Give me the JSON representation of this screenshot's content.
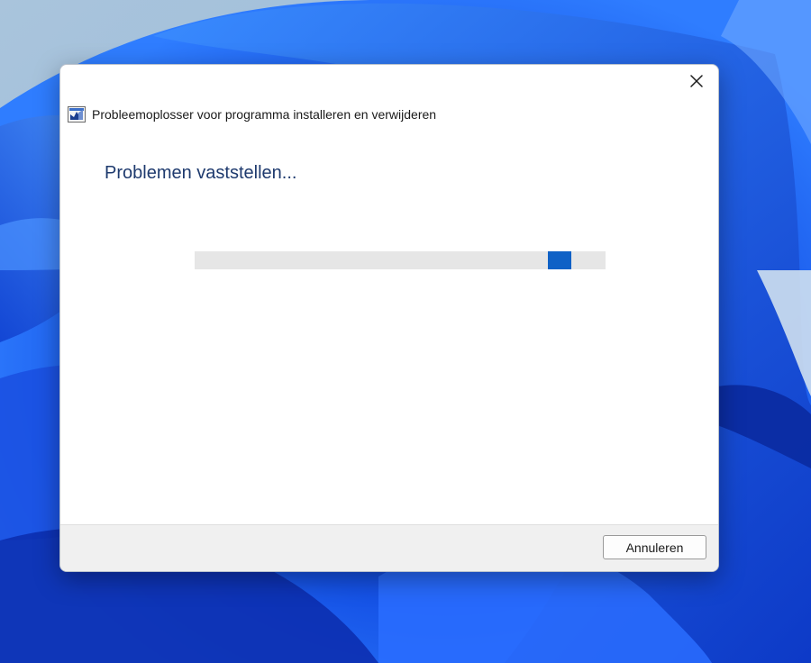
{
  "dialog": {
    "title": "Probleemoplosser voor programma installeren en verwijderen",
    "heading": "Problemen vaststellen...",
    "close_icon": "close-icon",
    "app_icon": "troubleshooter-icon",
    "progress": {
      "mode": "indeterminate",
      "chunk_start_fraction": 0.86,
      "chunk_width_fraction": 0.057,
      "color": "#0f61c6"
    },
    "cancel_label": "Annuleren"
  },
  "colors": {
    "accent": "#0f61c6",
    "heading": "#1e3a6e",
    "footer": "#f0f0f0"
  }
}
